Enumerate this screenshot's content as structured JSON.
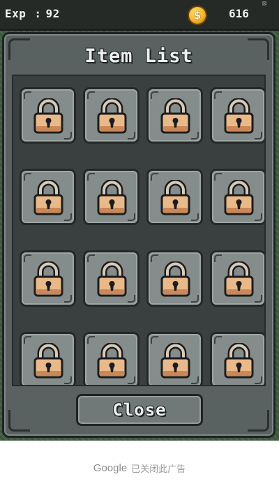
{
  "hud": {
    "exp_label": "Exp",
    "exp_sep": ":",
    "exp_value": "92",
    "coin_symbol": "$",
    "coin_icon": "gold-coin-icon",
    "coins_value": "616"
  },
  "panel": {
    "title": "Item List",
    "close_label": "Close"
  },
  "items": [
    {
      "state": "locked",
      "icon": "padlock-icon"
    },
    {
      "state": "locked",
      "icon": "padlock-icon"
    },
    {
      "state": "locked",
      "icon": "padlock-icon"
    },
    {
      "state": "locked",
      "icon": "padlock-icon"
    },
    {
      "state": "locked",
      "icon": "padlock-icon"
    },
    {
      "state": "locked",
      "icon": "padlock-icon"
    },
    {
      "state": "locked",
      "icon": "padlock-icon"
    },
    {
      "state": "locked",
      "icon": "padlock-icon"
    },
    {
      "state": "locked",
      "icon": "padlock-icon"
    },
    {
      "state": "locked",
      "icon": "padlock-icon"
    },
    {
      "state": "locked",
      "icon": "padlock-icon"
    },
    {
      "state": "locked",
      "icon": "padlock-icon"
    },
    {
      "state": "locked",
      "icon": "padlock-icon"
    },
    {
      "state": "locked",
      "icon": "padlock-icon"
    },
    {
      "state": "locked",
      "icon": "padlock-icon"
    },
    {
      "state": "locked",
      "icon": "padlock-icon"
    }
  ],
  "ad_banner": {
    "brand": "Google",
    "message": "已关闭此广告"
  },
  "colors": {
    "panel": "#5a6161",
    "slot": "#858c8c",
    "lock_body": "#e9b98a",
    "coin": "#f3b52b"
  }
}
